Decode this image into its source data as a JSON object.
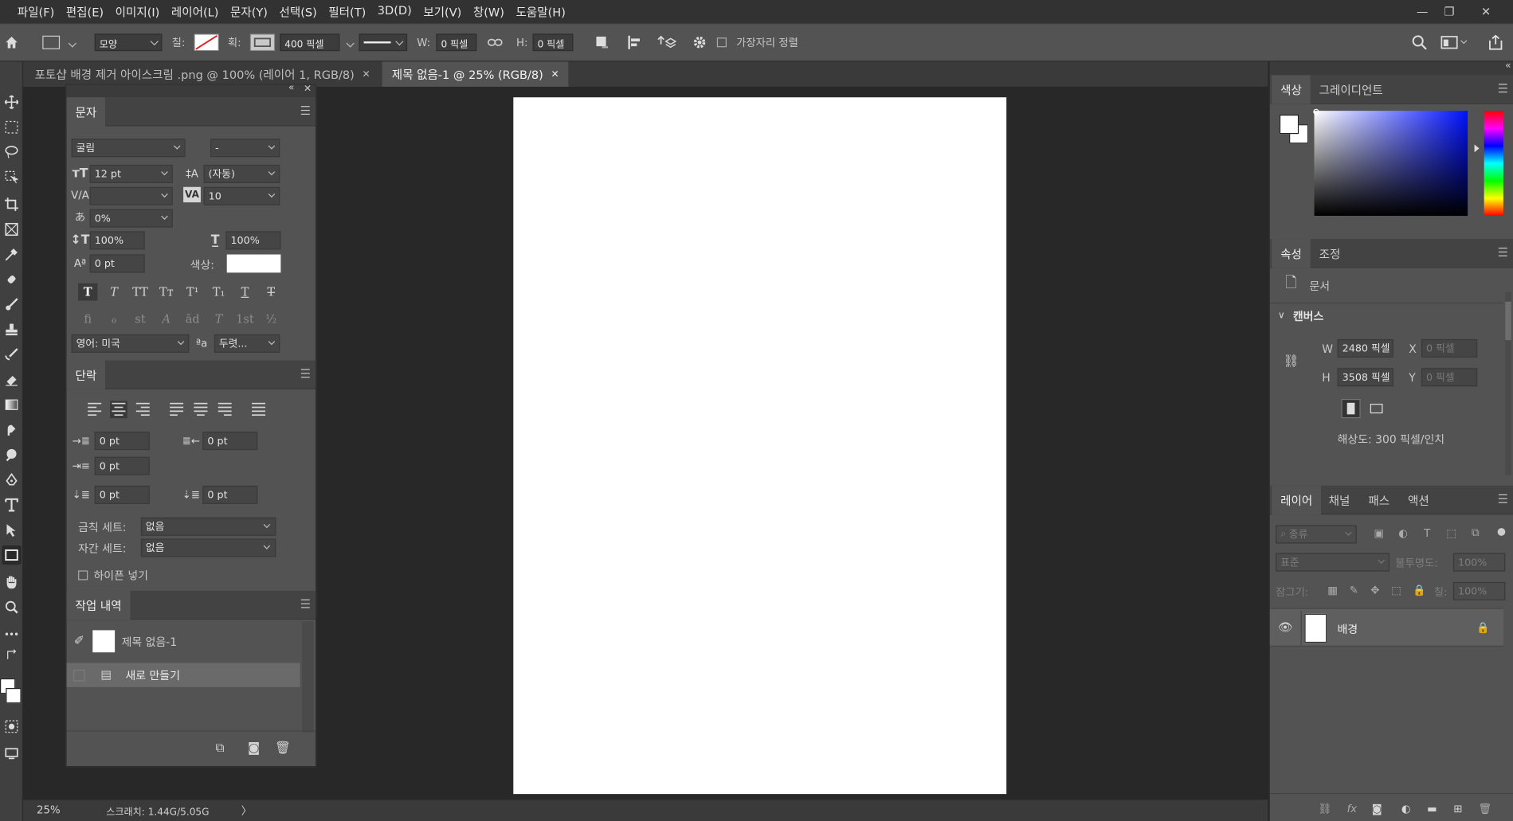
{
  "menubar": {
    "items": [
      "파일(F)",
      "편집(E)",
      "이미지(I)",
      "레이어(L)",
      "문자(Y)",
      "선택(S)",
      "필터(T)",
      "3D(D)",
      "보기(V)",
      "창(W)",
      "도움말(H)"
    ]
  },
  "options": {
    "shape_mode": "모양",
    "fill_label": "칠:",
    "stroke_label": "획:",
    "stroke_width": "400 픽셀",
    "w_label": "W:",
    "w_value": "0 픽셀",
    "h_label": "H:",
    "h_value": "0 픽셀",
    "align_edges_label": "가장자리 정렬"
  },
  "tabs": [
    {
      "label": "포토샵 배경 제거 아이스크림 .png @ 100% (레이어 1, RGB/8)"
    },
    {
      "label": "제목 없음-1 @ 25% (RGB/8)"
    }
  ],
  "character_panel": {
    "title": "문자",
    "font_family": "굴림",
    "font_style": "-",
    "size": "12 pt",
    "leading": "(자동)",
    "kerning": "",
    "tracking": "10",
    "tsume": "0%",
    "vscale": "100%",
    "hscale": "100%",
    "baseline": "0 pt",
    "color_label": "색상:",
    "language": "영어: 미국",
    "antialias": "두렷...",
    "style_buttons": [
      "T",
      "T",
      "TT",
      "Tт",
      "T¹",
      "T₁",
      "T",
      "T"
    ],
    "opentype_buttons": [
      "fi",
      "ℴ",
      "st",
      "A",
      "ād",
      "T",
      "1st",
      "½"
    ]
  },
  "paragraph_panel": {
    "title": "단락",
    "indent_left": "0 pt",
    "indent_right": "0 pt",
    "indent_first": "0 pt",
    "space_before": "0 pt",
    "space_after": "0 pt",
    "kinsoku_label": "금칙 세트:",
    "kinsoku_value": "없음",
    "mojikumi_label": "자간 세트:",
    "mojikumi_value": "없음",
    "hyphenate_label": "하이픈 넣기"
  },
  "history_panel": {
    "title": "작업 내역",
    "snapshot": "제목 없음-1",
    "steps": [
      "새로 만들기"
    ]
  },
  "color_panel": {
    "tabs": [
      "색상",
      "그레이디언트"
    ]
  },
  "properties_panel": {
    "tabs": [
      "속성",
      "조정"
    ],
    "doc_label": "문서",
    "section": "캔버스",
    "w_label": "W",
    "w_value": "2480 픽셀",
    "h_label": "H",
    "h_value": "3508 픽셀",
    "x_label": "X",
    "x_placeholder": "0 픽셀",
    "y_label": "Y",
    "y_placeholder": "0 픽셀",
    "resolution": "해상도: 300 픽셀/인치"
  },
  "layers_panel": {
    "tabs": [
      "레이어",
      "채널",
      "패스",
      "액션"
    ],
    "filter_placeholder": "종류",
    "blend_mode": "표준",
    "opacity_label": "불투명도:",
    "opacity": "100%",
    "lock_label": "잠그기:",
    "fill_label": "칠:",
    "fill": "100%",
    "layers": [
      {
        "name": "배경"
      }
    ]
  },
  "status": {
    "zoom": "25%",
    "scratch": "스크래치: 1.44G/5.05G",
    "arrow": "〉"
  },
  "colors": {
    "accent": "#2d8cf0"
  }
}
